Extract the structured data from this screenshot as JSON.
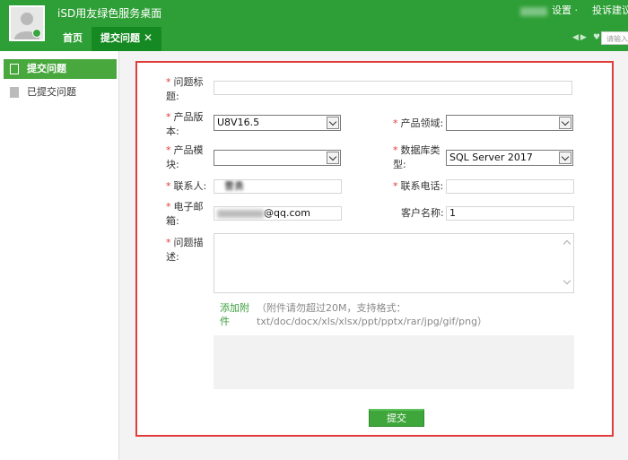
{
  "header": {
    "app_title": "iSD用友绿色服务桌面",
    "settings_label": "设置 ·",
    "feedback_label": "投诉建议",
    "search_placeholder": "请输入",
    "tabs": [
      {
        "label": "首页"
      },
      {
        "label": "提交问题",
        "close": "✕"
      }
    ]
  },
  "sidebar": {
    "items": [
      {
        "label": "提交问题",
        "active": true
      },
      {
        "label": "已提交问题",
        "active": false
      }
    ]
  },
  "form": {
    "required_mark": "*",
    "title_label": "问题标题:",
    "version_label": "产品版本:",
    "version_value": "U8V16.5",
    "domain_label": "产品领域:",
    "module_label": "产品模块:",
    "db_label": "数据库类型:",
    "db_value": "SQL Server 2017",
    "contact_label": "联系人:",
    "contact_value": "曹勇",
    "phone_label": "联系电话:",
    "email_label": "电子邮箱:",
    "email_value": "@qq.com",
    "customer_label": "客户名称:",
    "customer_value": "1",
    "desc_label": "问题描述:",
    "attach_label": "添加附件",
    "attach_note": "（附件请勿超过20M，支持格式：txt/doc/docx/xls/xlsx/ppt/pptx/rar/jpg/gif/png）",
    "submit_label": "提交"
  },
  "colors": {
    "header_green": "#2e9f36",
    "sidebar_active": "#48a83e",
    "frame_red": "#e03c3c",
    "required_red": "#e23b3b"
  }
}
